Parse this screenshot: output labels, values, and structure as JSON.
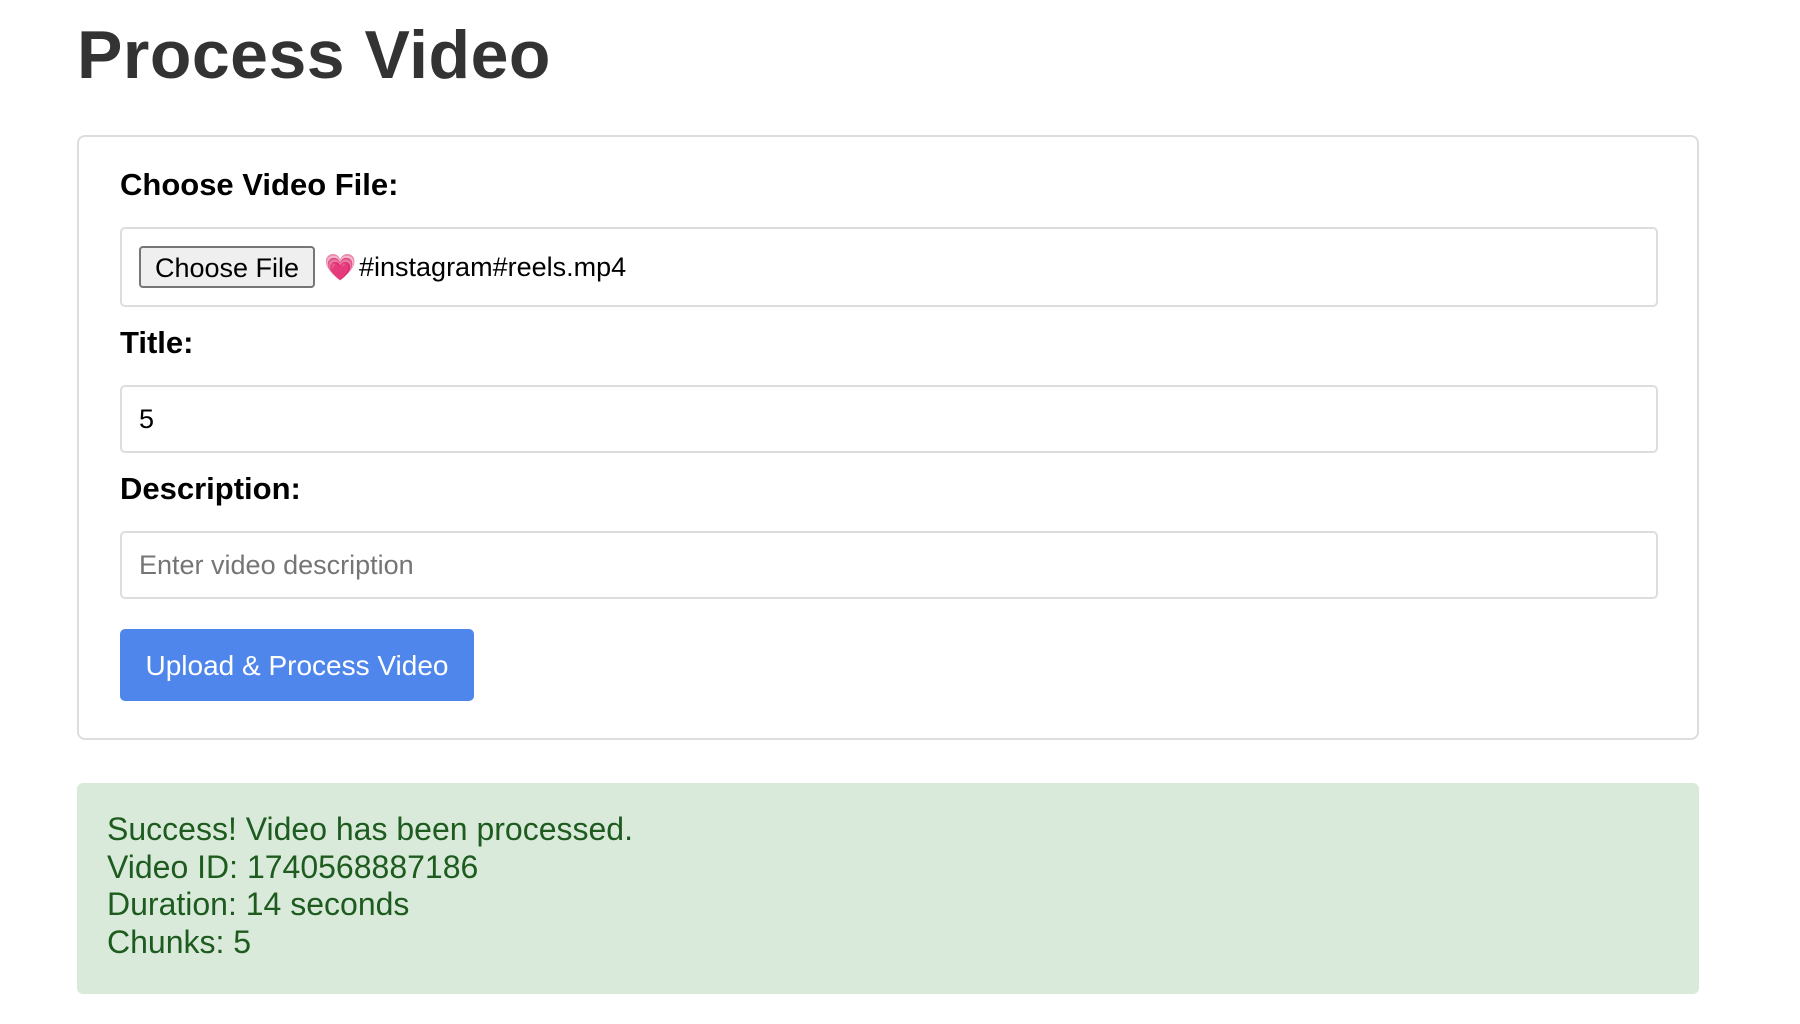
{
  "page": {
    "title": "Process Video"
  },
  "form": {
    "file": {
      "label": "Choose Video File:",
      "button_label": "Choose File",
      "selected_file_icon": "💗",
      "selected_file_name": "#instagram#reels.mp4"
    },
    "title": {
      "label": "Title:",
      "value": "5",
      "placeholder": ""
    },
    "description": {
      "label": "Description:",
      "value": "",
      "placeholder": "Enter video description"
    },
    "submit_label": "Upload & Process Video"
  },
  "result": {
    "lines": [
      "Success! Video has been processed.",
      "Video ID: 1740568887186",
      "Duration: 14 seconds",
      "Chunks: 5"
    ]
  },
  "colors": {
    "accent": "#4f86ec",
    "success_bg": "#d9eadb",
    "success_text": "#1e5b1e",
    "heading": "#333333",
    "border": "#dddddd"
  }
}
